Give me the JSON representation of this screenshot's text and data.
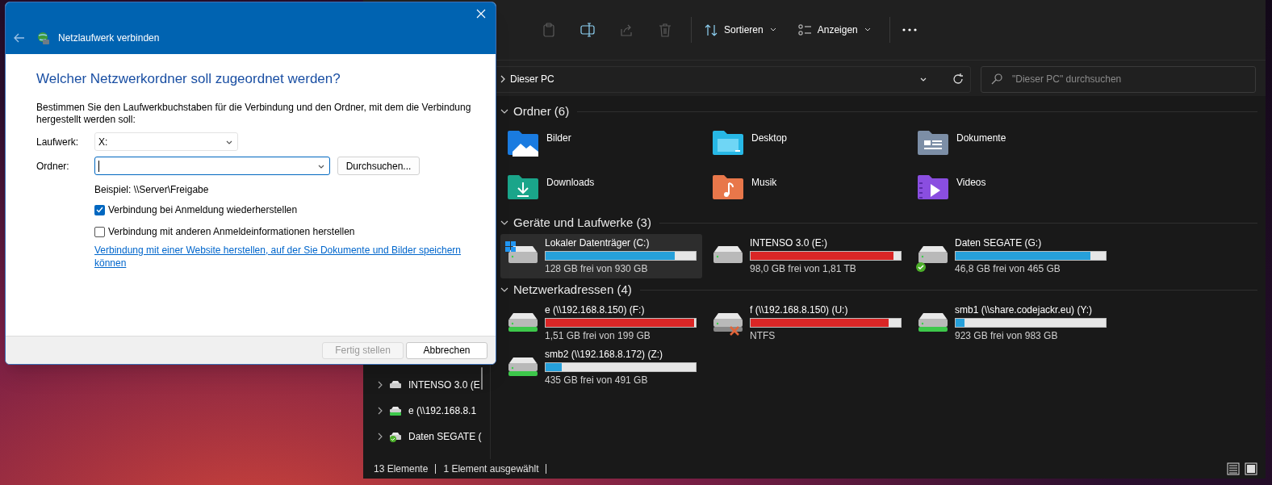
{
  "dialog": {
    "title": "Netzlaufwerk verbinden",
    "heading": "Welcher Netzwerkordner soll zugeordnet werden?",
    "description": "Bestimmen Sie den Laufwerkbuchstaben für die Verbindung und den Ordner, mit dem die Verbindung hergestellt werden soll:",
    "fields": [
      {
        "label": "Laufwerk:",
        "value": "X:",
        "focused": false
      },
      {
        "label": "Ordner:",
        "focused": true
      }
    ],
    "browse_button": "Durchsuchen...",
    "hint": "Beispiel: \\\\Server\\Freigabe",
    "checkboxes": [
      {
        "label": "Verbindung bei Anmeldung wiederherstellen",
        "checked": true
      },
      {
        "label": "Verbindung mit anderen Anmeldeinformationen herstellen",
        "checked": false
      }
    ],
    "link": "Verbindung mit einer Website herstellen, auf der Sie Dokumente und Bilder speichern können",
    "buttons": [
      {
        "label": "Fertig stellen",
        "disabled": true
      },
      {
        "label": "Abbrechen",
        "disabled": false
      }
    ]
  },
  "explorer": {
    "toolbar": {
      "icons": [
        {
          "kind": "paste",
          "disabled": true
        },
        {
          "kind": "rename",
          "disabled": false
        },
        {
          "kind": "share",
          "disabled": true
        },
        {
          "kind": "delete",
          "disabled": true
        }
      ],
      "menus": [
        {
          "kind": "sort",
          "label": "Sortieren"
        },
        {
          "kind": "view",
          "label": "Anzeigen"
        }
      ]
    },
    "address": "Dieser PC",
    "search_placeholder": "\"Dieser PC\" durchsuchen",
    "nav_items": [
      {
        "label": "INTENSO 3.0 (E",
        "kind": "drive"
      },
      {
        "label": "e (\\\\192.168.8.1",
        "kind": "network"
      },
      {
        "label": "Daten SEGATE (",
        "kind": "sync"
      }
    ],
    "sections": [
      {
        "title": "Ordner (6)",
        "kind": "folders",
        "items": [
          {
            "label": "Bilder",
            "kind": "pictures"
          },
          {
            "label": "Desktop",
            "kind": "desktop"
          },
          {
            "label": "Dokumente",
            "kind": "documents"
          },
          {
            "label": "Downloads",
            "kind": "downloads"
          },
          {
            "label": "Musik",
            "kind": "music"
          },
          {
            "label": "Videos",
            "kind": "videos"
          }
        ]
      },
      {
        "title": "Geräte und Laufwerke (3)",
        "kind": "drives",
        "items": [
          {
            "label": "Lokaler Datenträger (C:)",
            "detail": "128 GB frei von 930 GB",
            "level": 0.86,
            "color": "#26a0da",
            "kind": "system",
            "selected": true
          },
          {
            "label": "INTENSO 3.0 (E:)",
            "detail": "98,0 GB frei von 1,81 TB",
            "level": 0.95,
            "color": "#da2626",
            "kind": "drive",
            "selected": false
          },
          {
            "label": "Daten SEGATE (G:)",
            "detail": "46,8 GB frei von 465 GB",
            "level": 0.9,
            "color": "#26a0da",
            "kind": "sync",
            "selected": false
          }
        ]
      },
      {
        "title": "Netzwerkadressen (4)",
        "kind": "drives",
        "items": [
          {
            "label": "e (\\\\192.168.8.150) (F:)",
            "detail": "1,51 GB frei von 199 GB",
            "level": 0.99,
            "color": "#da2626",
            "kind": "network",
            "selected": false
          },
          {
            "label": "f (\\\\192.168.8.150) (U:)",
            "detail": "NTFS",
            "level": 0.92,
            "color": "#da2626",
            "kind": "disconnected",
            "selected": false
          },
          {
            "label": "smb1 (\\\\share.codejackr.eu) (Y:)",
            "detail": "923 GB frei von 983 GB",
            "level": 0.06,
            "color": "#26a0da",
            "kind": "network",
            "selected": false
          },
          {
            "label": "smb2 (\\\\192.168.8.172) (Z:)",
            "detail": "435 GB frei von 491 GB",
            "level": 0.11,
            "color": "#26a0da",
            "kind": "network",
            "selected": false
          }
        ]
      }
    ],
    "status_bar": [
      "13 Elemente",
      "1 Element ausgewählt"
    ]
  }
}
